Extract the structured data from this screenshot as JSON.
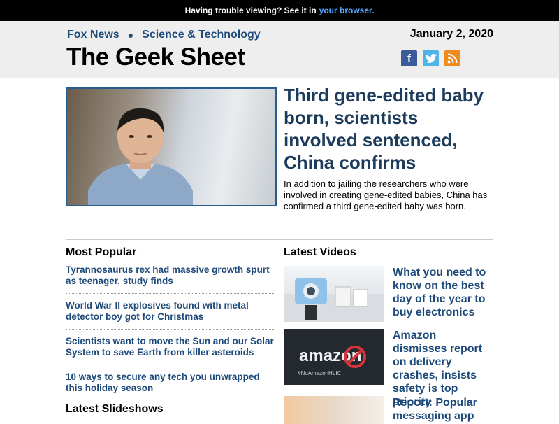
{
  "topbar": {
    "text": "Having trouble viewing? See it in",
    "link": "your browser."
  },
  "header": {
    "crumb1": "Fox News",
    "crumb2": "Science & Technology",
    "brand": "The Geek Sheet",
    "date": "January 2, 2020",
    "social": [
      "facebook-icon",
      "twitter-icon",
      "rss-icon"
    ]
  },
  "hero": {
    "headline": "Third gene-edited baby born, scientists involved sentenced, China confirms",
    "summary": "In addition to jailing the researchers who were involved in creating gene-edited babies, China has confirmed a third gene-edited baby was born."
  },
  "most_popular": {
    "title": "Most Popular",
    "items": [
      "Tyrannosaurus rex had massive growth spurt as teenager, study finds",
      "World War II explosives found with metal detector boy got for Christmas",
      "Scientists want to move the Sun and our Solar System to save Earth from killer asteroids",
      "10 ways to secure any tech you unwrapped this holiday season"
    ]
  },
  "slideshows": {
    "title": "Latest Slideshows"
  },
  "videos": {
    "title": "Latest Videos",
    "items": [
      "What you need to know on the best day of the year to buy electronics",
      "Amazon dismisses report on delivery crashes, insists safety is top priority",
      "Report: Popular messaging app"
    ],
    "thumb2_text": "amazon",
    "thumb2_hashtag": "#NoAmazonHLIC"
  },
  "colors": {
    "link": "#1d4a7a",
    "headline": "#1d3c5c",
    "facebook": "#3b5a9a",
    "twitter": "#4fb4e6",
    "rss": "#ef8a1d"
  }
}
